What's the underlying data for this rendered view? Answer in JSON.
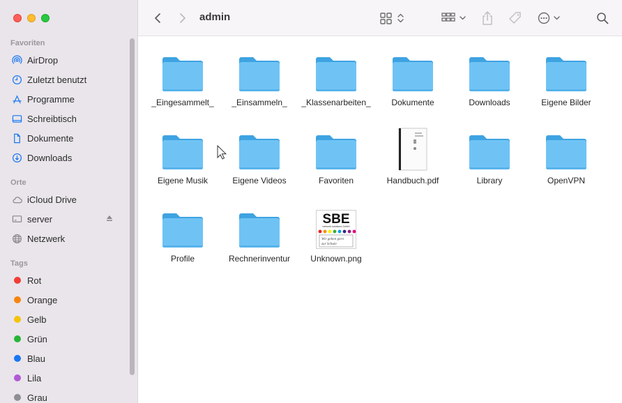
{
  "window": {
    "title": "admin"
  },
  "sidebar": {
    "favorites_header": "Favoriten",
    "favorites": [
      {
        "label": "AirDrop",
        "icon": "airdrop-icon"
      },
      {
        "label": "Zuletzt benutzt",
        "icon": "clock-icon"
      },
      {
        "label": "Programme",
        "icon": "apps-icon"
      },
      {
        "label": "Schreibtisch",
        "icon": "desktop-icon"
      },
      {
        "label": "Dokumente",
        "icon": "document-icon"
      },
      {
        "label": "Downloads",
        "icon": "download-icon"
      }
    ],
    "locations_header": "Orte",
    "locations": [
      {
        "label": "iCloud Drive",
        "icon": "cloud-icon"
      },
      {
        "label": "server",
        "icon": "display-icon"
      },
      {
        "label": "Netzwerk",
        "icon": "globe-icon"
      }
    ],
    "tags_header": "Tags",
    "tags": [
      {
        "label": "Rot",
        "color": "#f23d36"
      },
      {
        "label": "Orange",
        "color": "#f6850f"
      },
      {
        "label": "Gelb",
        "color": "#f5c30a"
      },
      {
        "label": "Grün",
        "color": "#27b536"
      },
      {
        "label": "Blau",
        "color": "#1a77f2"
      },
      {
        "label": "Lila",
        "color": "#b05ad6"
      },
      {
        "label": "Grau",
        "color": "#8e8e93"
      }
    ]
  },
  "files": [
    {
      "name": "_Eingesammelt_",
      "type": "folder"
    },
    {
      "name": "_Einsammeln_",
      "type": "folder"
    },
    {
      "name": "_Klassenarbeiten_",
      "type": "folder"
    },
    {
      "name": "Dokumente",
      "type": "folder"
    },
    {
      "name": "Downloads",
      "type": "folder"
    },
    {
      "name": "Eigene Bilder",
      "type": "folder"
    },
    {
      "name": "Eigene Musik",
      "type": "folder"
    },
    {
      "name": "Eigene Videos",
      "type": "folder"
    },
    {
      "name": "Favoriten",
      "type": "folder"
    },
    {
      "name": "Handbuch.pdf",
      "type": "pdf"
    },
    {
      "name": "Library",
      "type": "folder"
    },
    {
      "name": "OpenVPN",
      "type": "folder"
    },
    {
      "name": "Profile",
      "type": "folder"
    },
    {
      "name": "Rechnerinventur",
      "type": "folder"
    },
    {
      "name": "Unknown.png",
      "type": "image"
    }
  ],
  "png_thumb": {
    "logo": "SBE",
    "tagline": "network solutions GmbH",
    "slogan_line1": "Wir gehen gern",
    "slogan_line2": "zur Schule"
  },
  "colors": {
    "folder_front": "#6fc3f4",
    "folder_back": "#3ea3e2",
    "accent": "#1a77f2"
  }
}
